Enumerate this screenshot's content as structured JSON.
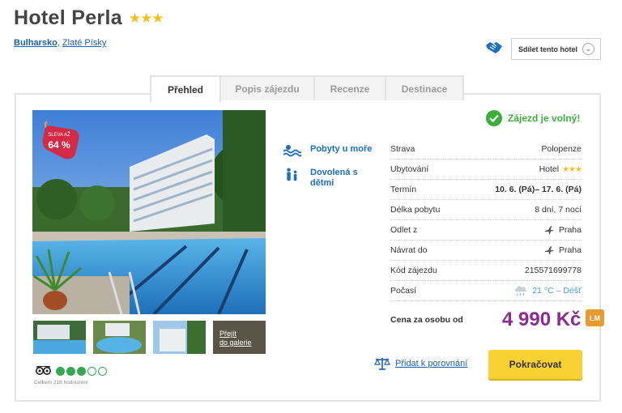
{
  "hotel": {
    "name": "Hotel Perla",
    "stars": "★★★"
  },
  "breadcrumb": {
    "country": "Bulharsko",
    "separator": ",",
    "resort": "Zlaté Písky"
  },
  "share": {
    "label": "Sdílet tento hotel",
    "chevron": "⌄"
  },
  "tabs": [
    {
      "label": "Přehled",
      "active": true
    },
    {
      "label": "Popis zájezdu",
      "active": false
    },
    {
      "label": "Recenze",
      "active": false
    },
    {
      "label": "Destinace",
      "active": false
    }
  ],
  "discount": {
    "label": "SLEVA AŽ",
    "value": "64 %"
  },
  "gallery_link": {
    "line1": "Přejít",
    "line2": "do galerie"
  },
  "rating": {
    "filled": 3,
    "total": 5,
    "count_text": "Celkem 216 hodnocení"
  },
  "features": [
    {
      "icon": "sea-waves-icon",
      "label_lines": [
        "Pobyty u moře"
      ]
    },
    {
      "icon": "family-icon",
      "label_lines": [
        "Dovolená s",
        "dětmi"
      ]
    }
  ],
  "availability": {
    "text": "Zájezd je volný!",
    "color": "#3dae3b"
  },
  "details": [
    {
      "label": "Strava",
      "value": "Polopenze"
    },
    {
      "label": "Ubytování",
      "value": "Hotel",
      "stars": "★★★"
    },
    {
      "label": "Termín",
      "value": "10. 6. (Pá)– 17. 6. (Pá)",
      "bold": true
    },
    {
      "label": "Délka pobytu",
      "value": "8 dní, 7 nocí"
    },
    {
      "label": "Odlet z",
      "value": "Praha",
      "icon": "plane-icon"
    },
    {
      "label": "Návrat do",
      "value": "Praha",
      "icon": "plane-icon"
    },
    {
      "label": "Kód zájezdu",
      "value": "215571699778"
    },
    {
      "label": "Počasí",
      "value": "21 °C – Déšť",
      "icon": "rain-cloud-icon"
    }
  ],
  "price": {
    "label": "Cena za osobu od",
    "value": "4 990 Kč",
    "badge": "LM",
    "color": "#8b2c8e"
  },
  "compare": {
    "label": "Přidat k porovnání"
  },
  "continue": {
    "label": "Pokračovat",
    "color": "#f8d232"
  }
}
